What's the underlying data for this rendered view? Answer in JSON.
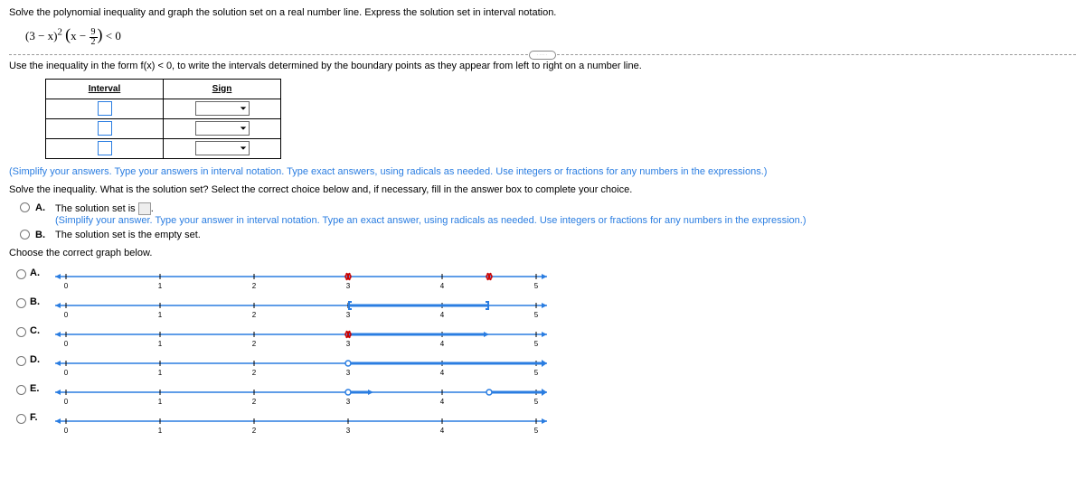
{
  "prompt": "Solve the polynomial inequality and graph the solution set on a real number line. Express the solution set in interval notation.",
  "expression": {
    "part1": "(3 − x)",
    "exp1": "2",
    "inner_open": "(",
    "x_minus": "x − ",
    "frac_num": "9",
    "frac_den": "2",
    "inner_close": ")",
    "rel": " < 0"
  },
  "instr2": "Use the inequality in the form f(x) < 0, to write the intervals determined by the boundary points as they appear from left to right on a number line.",
  "table": {
    "col1": "Interval",
    "col2": "Sign"
  },
  "simplify_note": "(Simplify your answers. Type your answers in interval notation. Type exact answers, using radicals as needed. Use integers or fractions for any numbers in the expressions.)",
  "solve_prompt": "Solve the inequality. What is the solution set? Select the correct choice below and, if necessary, fill in the answer box to complete your choice.",
  "choices": {
    "A": {
      "label": "A.",
      "text_before": "The solution set is ",
      "text_after": ".",
      "note": "(Simplify your answer. Type your answer in interval notation. Type an exact answer, using radicals as needed. Use integers or fractions for any numbers in the expression.)"
    },
    "B": {
      "label": "B.",
      "text": "The solution set is the empty set."
    }
  },
  "graph_prompt": "Choose the correct graph below.",
  "graphs": {
    "A": {
      "label": "A."
    },
    "B": {
      "label": "B."
    },
    "C": {
      "label": "C."
    },
    "D": {
      "label": "D."
    },
    "E": {
      "label": "E."
    },
    "F": {
      "label": "F."
    }
  },
  "chart_data": {
    "type": "number_lines",
    "ticks": [
      0,
      1,
      2,
      3,
      4,
      5
    ],
    "lines": [
      {
        "id": "A",
        "arrows": "both",
        "line_color": "blue",
        "marks": [
          {
            "x": 3,
            "style": "open-x"
          },
          {
            "x": 4.5,
            "style": "open-x"
          }
        ]
      },
      {
        "id": "B",
        "arrows": "both",
        "segment": [
          3,
          4.5
        ],
        "segment_ends": "closed",
        "line_color": "blue"
      },
      {
        "id": "C",
        "arrows": "both",
        "segment": [
          3,
          4.5
        ],
        "segment_ends": "open-x",
        "segment_arrow": "right",
        "line_color": "blue"
      },
      {
        "id": "D",
        "arrows": "both",
        "ray": {
          "from": 3,
          "dir": "right",
          "end": "open"
        },
        "line_color": "blue"
      },
      {
        "id": "E",
        "arrows": "both",
        "ray": {
          "from": 3,
          "dir": "right",
          "end": "open-arrow-mid"
        },
        "ray2": {
          "from": 4.5,
          "dir": "right",
          "end": "open"
        },
        "line_color": "blue"
      },
      {
        "id": "F",
        "arrows": "both",
        "line_color": "blue",
        "plain": true
      }
    ]
  }
}
